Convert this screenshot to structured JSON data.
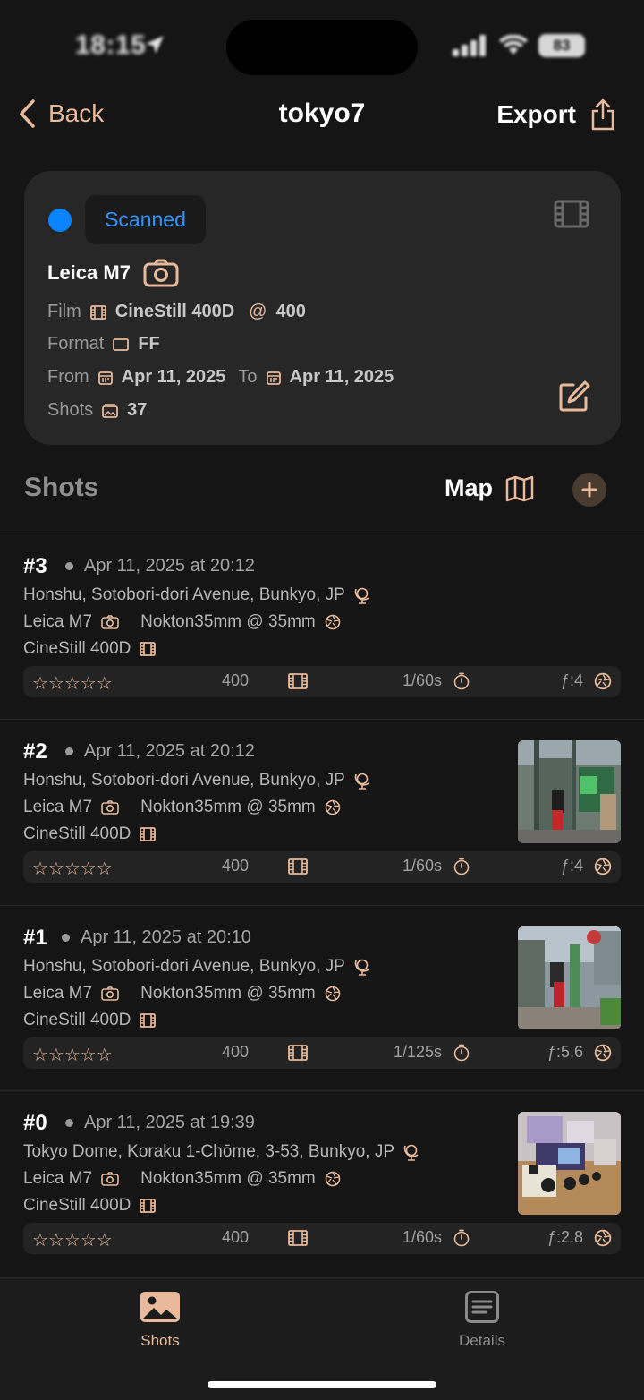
{
  "status_bar": {
    "time": "18:15",
    "battery": "83"
  },
  "nav": {
    "back_label": "Back",
    "title": "tokyo7",
    "export_label": "Export"
  },
  "roll": {
    "status": "Scanned",
    "camera": "Leica M7",
    "film_label": "Film",
    "film_value": "CineStill 400D",
    "at": "@",
    "iso": "400",
    "format_label": "Format",
    "format_value": "FF",
    "from_label": "From",
    "from_value": "Apr 11, 2025",
    "to_label": "To",
    "to_value": "Apr 11, 2025",
    "shots_label": "Shots",
    "shots_value": "37"
  },
  "shots_section": {
    "title": "Shots",
    "map_label": "Map"
  },
  "shots": [
    {
      "num": "#3",
      "date": "Apr 11, 2025 at 20:12",
      "location": "Honshu, Sotobori-dori Avenue, Bunkyo, JP",
      "camera": "Leica M7",
      "lens": "Nokton35mm @ 35mm",
      "film": "CineStill 400D",
      "rating": "☆☆☆☆☆",
      "iso": "400",
      "shutter": "1/60s",
      "aperture": "ƒ:4"
    },
    {
      "num": "#2",
      "date": "Apr 11, 2025 at 20:12",
      "location": "Honshu, Sotobori-dori Avenue, Bunkyo, JP",
      "camera": "Leica M7",
      "lens": "Nokton35mm @ 35mm",
      "film": "CineStill 400D",
      "rating": "☆☆☆☆☆",
      "iso": "400",
      "shutter": "1/60s",
      "aperture": "ƒ:4"
    },
    {
      "num": "#1",
      "date": "Apr 11, 2025 at 20:10",
      "location": "Honshu, Sotobori-dori Avenue, Bunkyo, JP",
      "camera": "Leica M7",
      "lens": "Nokton35mm @ 35mm",
      "film": "CineStill 400D",
      "rating": "☆☆☆☆☆",
      "iso": "400",
      "shutter": "1/125s",
      "aperture": "ƒ:5.6"
    },
    {
      "num": "#0",
      "date": "Apr 11, 2025 at 19:39",
      "location": "Tokyo Dome, Koraku 1-Chōme, 3-53, Bunkyo, JP",
      "camera": "Leica M7",
      "lens": "Nokton35mm @ 35mm",
      "film": "CineStill 400D",
      "rating": "☆☆☆☆☆",
      "iso": "400",
      "shutter": "1/60s",
      "aperture": "ƒ:2.8"
    }
  ],
  "tabs": {
    "shots": "Shots",
    "details": "Details"
  },
  "colors": {
    "accent": "#e8b99a",
    "status_blue": "#0a84ff",
    "background": "#151515",
    "card": "#272727"
  }
}
